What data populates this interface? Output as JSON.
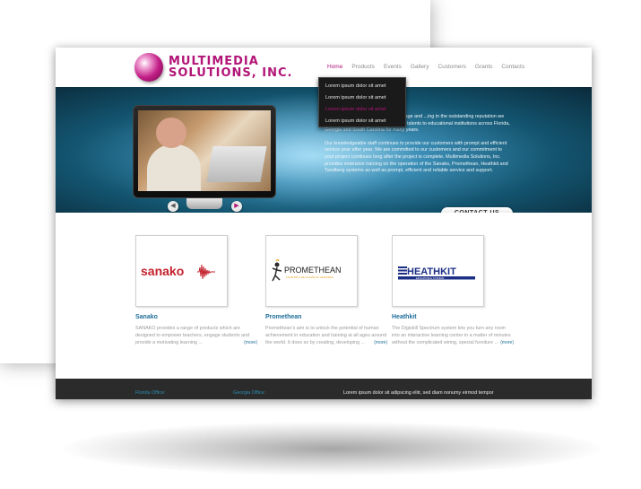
{
  "logo": {
    "line1": "MULTIMEDIA",
    "line2": "SOLUTIONS, INC."
  },
  "nav": [
    {
      "label": "Home",
      "active": true
    },
    {
      "label": "Products"
    },
    {
      "label": "Events"
    },
    {
      "label": "Gallery"
    },
    {
      "label": "Customers"
    },
    {
      "label": "Grants"
    },
    {
      "label": "Contacts"
    }
  ],
  "dropdown": [
    "Lorem ipsum dolor sit amet",
    "Lorem ipsum dolor sit amet",
    "Lorem ipsum dolor sit amet",
    "Lorem ipsum dolor sit amet"
  ],
  "hero": {
    "paragraph1": "...ted to serving the educational language and ...ing in the outstanding reputation we have earned by devoting our time and talents to educational institutions across Florida, Georgia and South Carolina for many years.",
    "paragraph2": "Our knowledgeable staff continues to provide our customers with prompt and efficient service year after year. We are committed to our customers and our commitment to your project continues long after the project is complete. Multimedia Solutions, Inc. provides extensive training on the operation of the Sanako, Promethean, Heathkit and Tandberg systems as well as prompt, efficient and reliable service and support.",
    "contact_label": "CONTACT US",
    "arrow_left": "◀",
    "arrow_right": "▶"
  },
  "products": [
    {
      "logo_text": "sanako",
      "title": "Sanako",
      "description": "SANAKO provides a range of products which are designed to empower teachers, engage students and provide a motivating learning ...",
      "more": "(more)"
    },
    {
      "logo_text": "PROMETHEAN",
      "logo_subtext": "LIGHTING THE FLAME OF LEARNING",
      "title": "Promethean",
      "description": "Promethean’s aim is to unlock the potential of human achievement in education and training at all ages around the world. It does so by creating, developing ...",
      "more": "(more)"
    },
    {
      "logo_text": "HEATHKIT",
      "logo_subtext": "EDUCATIONAL SYSTEMS",
      "title": "Heathkit",
      "description": "The Digiskill Spectrum system lets you turn any room into an interactive learning center in a matter of minutes without the complicated wiring, special furniture ...",
      "more": "(more)"
    }
  ],
  "footer": {
    "florida": "Florida Office:",
    "georgia": "Georgia Office:",
    "tagline": "Lorem ipsum dolor sit adipscing elitr, sed diam nonumy eirmod tempor"
  },
  "colors": {
    "accent": "#b21577",
    "link": "#1f6e9a",
    "footer_bg": "#2b2b2b"
  }
}
